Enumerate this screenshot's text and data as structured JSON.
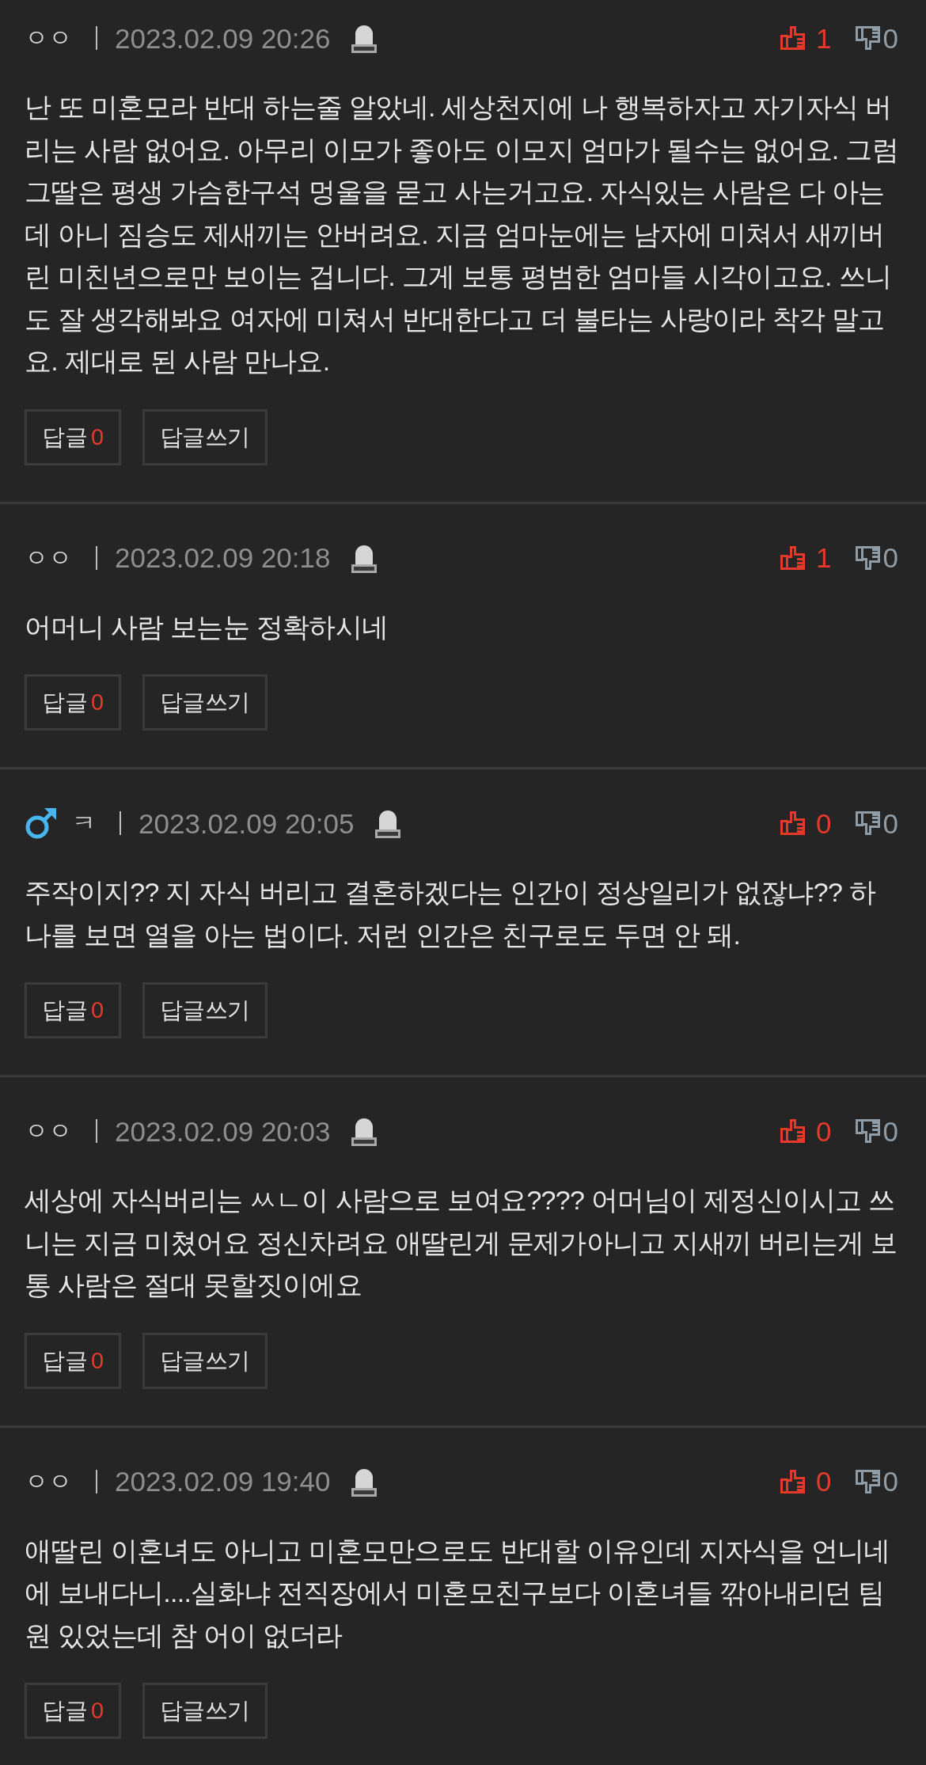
{
  "comments": [
    {
      "author": "ㅇㅇ",
      "male": false,
      "date": "2023.02.09 20:26",
      "likes": "1",
      "dislikes": "0",
      "text": "난 또 미혼모라 반대 하는줄 알았네. 세상천지에 나 행복하자고 자기자식 버리는 사람 없어요. 아무리 이모가 좋아도 이모지 엄마가 될수는 없어요. 그럼 그딸은 평생 가슴한구석 멍울을 묻고 사는거고요. 자식있는 사람은 다 아는데 아니 짐승도 제새끼는 안버려요. 지금 엄마눈에는 남자에 미쳐서 새끼버린 미친년으로만 보이는 겁니다. 그게 보통 평범한 엄마들 시각이고요. 쓰니도 잘 생각해봐요 여자에 미쳐서 반대한다고 더 불타는 사랑이라 착각 말고요. 제대로 된 사람 만나요.",
      "reply_label": "답글",
      "reply_count": "0",
      "write_label": "답글쓰기"
    },
    {
      "author": "ㅇㅇ",
      "male": false,
      "date": "2023.02.09 20:18",
      "likes": "1",
      "dislikes": "0",
      "text": "어머니 사람 보는눈 정확하시네",
      "reply_label": "답글",
      "reply_count": "0",
      "write_label": "답글쓰기"
    },
    {
      "author": "ㅋ",
      "male": true,
      "date": "2023.02.09 20:05",
      "likes": "0",
      "dislikes": "0",
      "text": "주작이지?? 지 자식 버리고 결혼하겠다는 인간이 정상일리가 없잖냐?? 하나를 보면 열을 아는 법이다. 저런 인간은 친구로도 두면 안 돼.",
      "reply_label": "답글",
      "reply_count": "0",
      "write_label": "답글쓰기"
    },
    {
      "author": "ㅇㅇ",
      "male": false,
      "date": "2023.02.09 20:03",
      "likes": "0",
      "dislikes": "0",
      "text": "세상에 자식버리는 ㅆㄴ이 사람으로 보여요???? 어머님이 제정신이시고 쓰니는 지금 미쳤어요 정신차려요 애딸린게 문제가아니고 지새끼 버리는게 보통 사람은 절대 못할짓이에요",
      "reply_label": "답글",
      "reply_count": "0",
      "write_label": "답글쓰기"
    },
    {
      "author": "ㅇㅇ",
      "male": false,
      "date": "2023.02.09 19:40",
      "likes": "0",
      "dislikes": "0",
      "text": "애딸린 이혼녀도 아니고 미혼모만으로도 반대할 이유인데 지자식을 언니네에 보내다니....실화냐 전직장에서 미혼모친구보다 이혼녀들 깎아내리던 팀원 있었는데 참 어이 없더라",
      "reply_label": "답글",
      "reply_count": "0",
      "write_label": "답글쓰기"
    }
  ]
}
